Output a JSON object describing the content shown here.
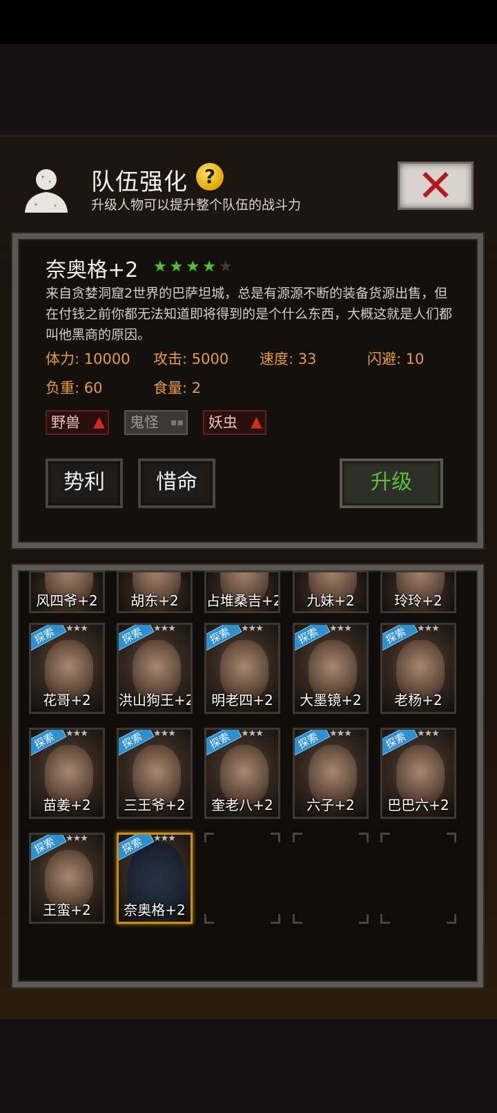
{
  "header": {
    "title": "队伍强化",
    "subtitle": "升级人物可以提升整个队伍的战斗力",
    "help_icon": "question-mark-icon",
    "close_icon": "close-x-icon",
    "help_glyph": "?",
    "close_glyph": "✕"
  },
  "character": {
    "name": "奈奥格+2",
    "stars_on": 4,
    "stars_total": 5,
    "description": "来自贪婪洞窟2世界的巴萨坦城，总是有源源不断的装备货源出售，但在付钱之前你都无法知道即将得到的是个什么东西，大概这就是人们都叫他黑商的原因。",
    "stats": {
      "hp": "体力: 10000",
      "attack": "攻击: 5000",
      "speed": "速度: 33",
      "dodge": "闪避: 10",
      "load": "负重: 60",
      "food": "食量: 2"
    },
    "tags": [
      {
        "label": "野兽",
        "arrow": "▲",
        "type": "up"
      },
      {
        "label": "鬼怪",
        "arrow": "▪▪",
        "type": "neutral"
      },
      {
        "label": "妖虫",
        "arrow": "▲",
        "type": "up"
      }
    ]
  },
  "buttons": {
    "skill1": "势利",
    "skill2": "惜命",
    "upgrade": "升级"
  },
  "roster": {
    "ribbon": "探索",
    "minis": "★★★",
    "partial_row": [
      "风四爷+2",
      "胡东+2",
      "占堆桑吉+2",
      "九妹+2",
      "玲玲+2"
    ],
    "row1": [
      "花哥+2",
      "洪山狗王+2",
      "明老四+2",
      "大墨镜+2",
      "老杨+2"
    ],
    "row2": [
      "苗姜+2",
      "三王爷+2",
      "奎老八+2",
      "六子+2",
      "巴巴六+2"
    ],
    "row3": [
      "王蛮+2",
      "奈奥格+2"
    ]
  },
  "colors": {
    "accent_stat": "#e79b3f",
    "star_on": "#55c033",
    "upgrade_text": "#5bc232",
    "selected_border": "#c98e16",
    "ribbon": "#2f8fd0"
  }
}
